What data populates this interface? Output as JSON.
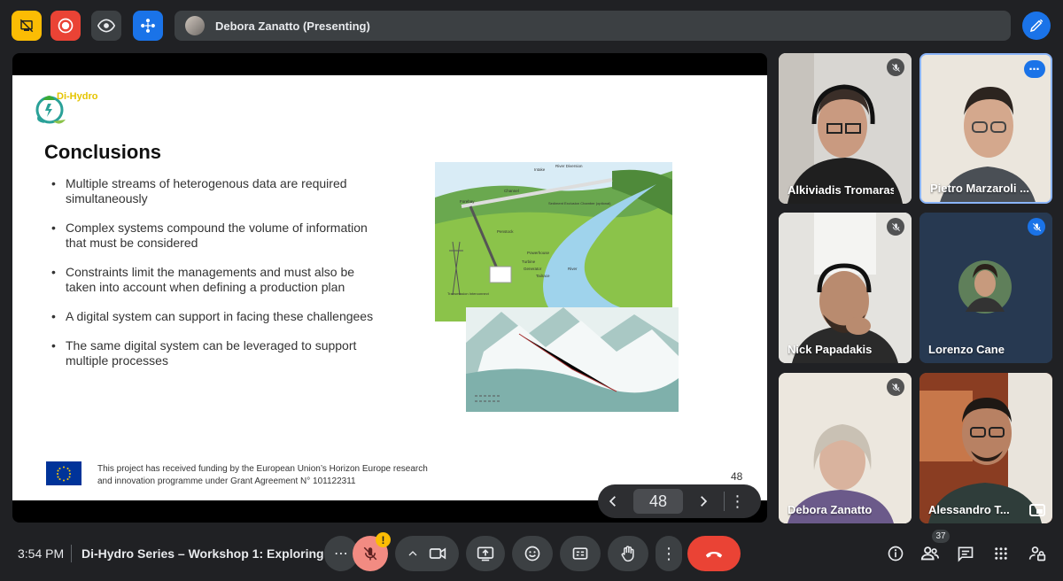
{
  "top_bar": {
    "presenter_text": "Debora Zanatto (Presenting)",
    "buttons": [
      {
        "name": "hide-self-icon",
        "color": "#fbbc04"
      },
      {
        "name": "record-icon",
        "color": "#ea4335"
      },
      {
        "name": "eye-icon",
        "color": "#3c4043"
      },
      {
        "name": "activities-icon",
        "color": "#1a73e8"
      }
    ],
    "annotate_color": "#1a73e8"
  },
  "slide": {
    "logo_text": "Di-Hydro",
    "title": "Conclusions",
    "bullets": [
      "Multiple streams of heterogenous data are required simultaneously",
      "Complex systems compound the volume of information that must be considered",
      "Constraints limit the managements and must also be taken into account when defining a production plan",
      "A digital system can support in facing these challengees",
      "The same digital system can be leveraged to support multiple processes"
    ],
    "figure_labels": {
      "intake": "Intake",
      "river_diversion": "River Diversion",
      "channel": "Channel",
      "forebay": "Forebay",
      "sediment": "Sediment Exclusion Chamber (optional)",
      "penstock": "Penstock",
      "powerhouse": "Powerhouse",
      "turbine": "Turbine",
      "generator": "Generator",
      "tailrace": "Tailrace",
      "river": "River",
      "transmission": "Transmission Interconnect"
    },
    "funding_line1": "This project has received funding by the European Union’s Horizon Europe research",
    "funding_line2": "and innovation programme under Grant Agreement N° 101122311",
    "page_number": "48"
  },
  "pager": {
    "current_page": "48",
    "prev": "‹",
    "next": "›",
    "more": "⋮"
  },
  "participants": [
    {
      "name": "Alkiviadis Tromaras",
      "muted": true
    },
    {
      "name": "Pietro Marzaroli ...",
      "muted": false
    },
    {
      "name": "Nick Papadakis",
      "muted": true
    },
    {
      "name": "Lorenzo Cane",
      "muted": true
    },
    {
      "name": "Debora Zanatto",
      "muted": true
    },
    {
      "name": "Alessandro T...",
      "muted": false
    }
  ],
  "bottom_bar": {
    "time": "3:54 PM",
    "meeting_title": "Di-Hydro Series – Workshop 1: Exploring...",
    "mic_warning": "!",
    "people_count": "37",
    "more_label": "⋯",
    "more_vertical": "⋮"
  }
}
